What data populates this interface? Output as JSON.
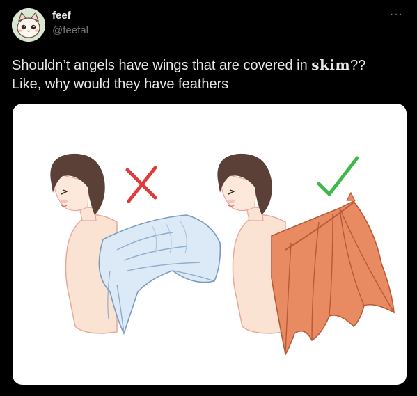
{
  "author": {
    "display_name": "feef",
    "handle": "@feefal_",
    "avatar_icon": "cat-avatar-icon"
  },
  "more_icon": "more-options-icon",
  "more_label": "···",
  "tweet": {
    "line1_before": "Shouldn’t angels have wings that are covered in ",
    "line1_stylized": "skim",
    "line1_after": "??",
    "line2": "Like, why would they have feathers"
  },
  "media": {
    "left_mark_icon": "red-x-icon",
    "right_mark_icon": "green-check-icon",
    "left_wing_icon": "feathered-wing-icon",
    "right_wing_icon": "bat-wing-icon",
    "colors": {
      "x_mark": "#e03a3a",
      "check_mark": "#3fb84a",
      "feather_wing": "#dce9f6",
      "bat_wing": "#e88a62",
      "hair": "#5a4036",
      "skin": "#fbe1d0"
    }
  }
}
